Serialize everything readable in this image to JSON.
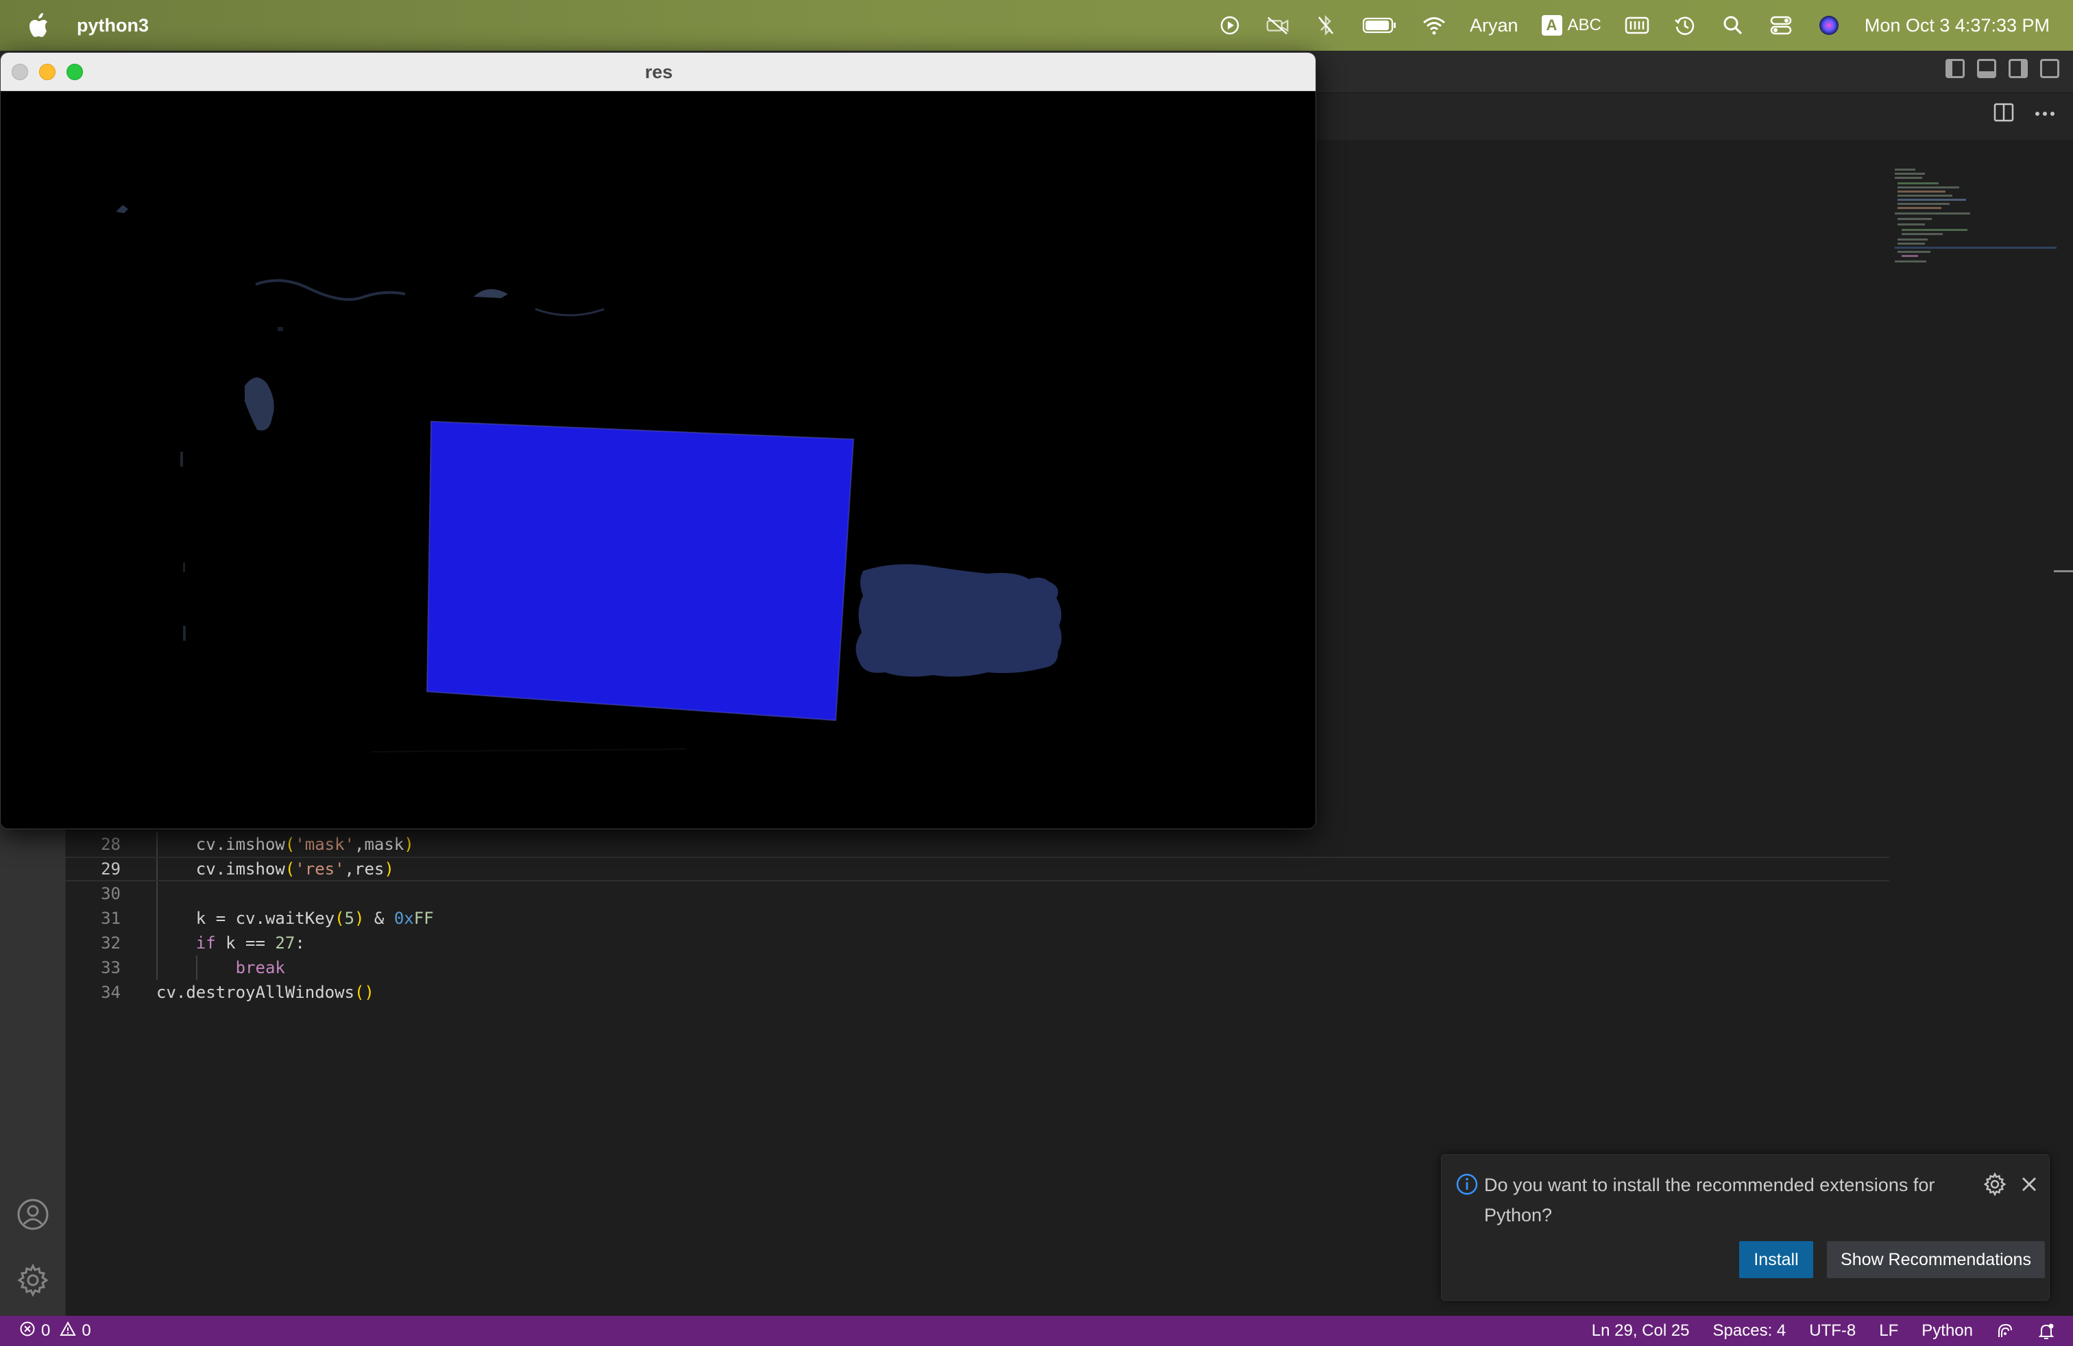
{
  "menubar": {
    "app_name": "python3",
    "user": "Aryan",
    "input_source": "ABC",
    "datetime": "Mon Oct 3  4:37:33 PM"
  },
  "cv_window": {
    "title": "res"
  },
  "editor": {
    "lines": [
      {
        "num": "28",
        "code": "    cv.imshow('mask',mask)"
      },
      {
        "num": "29",
        "code": "    cv.imshow('res',res)"
      },
      {
        "num": "30",
        "code": ""
      },
      {
        "num": "31",
        "code": "    k = cv.waitKey(5) & 0xFF"
      },
      {
        "num": "32",
        "code": "    if k == 27:"
      },
      {
        "num": "33",
        "code": "        break"
      },
      {
        "num": "34",
        "code": "cv.destroyAllWindows()"
      }
    ],
    "active_line": "29"
  },
  "notification": {
    "message": "Do you want to install the recommended extensions for Python?",
    "install_label": "Install",
    "recommendations_label": "Show Recommendations"
  },
  "statusbar": {
    "errors": "0",
    "warnings": "0",
    "cursor_position": "Ln 29, Col 25",
    "indentation": "Spaces: 4",
    "encoding": "UTF-8",
    "line_ending": "LF",
    "language": "Python"
  },
  "colors": {
    "statusbar_bg": "#68217a",
    "install_button": "#0e639c",
    "cv_blue_object": "#1a1ae0"
  }
}
